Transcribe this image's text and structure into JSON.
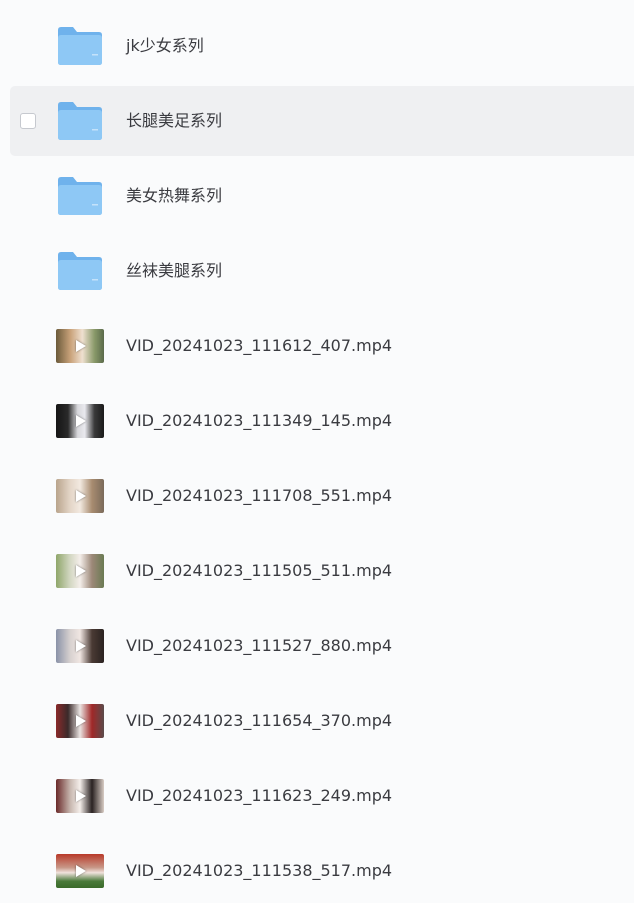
{
  "items": [
    {
      "type": "folder",
      "name": "jk少女系列",
      "selected": false
    },
    {
      "type": "folder",
      "name": "长腿美足系列",
      "selected": true
    },
    {
      "type": "folder",
      "name": "美女热舞系列",
      "selected": false
    },
    {
      "type": "folder",
      "name": "丝袜美腿系列",
      "selected": false
    },
    {
      "type": "video",
      "name": "VID_20241023_111612_407.mp4",
      "selected": false
    },
    {
      "type": "video",
      "name": "VID_20241023_111349_145.mp4",
      "selected": false
    },
    {
      "type": "video",
      "name": "VID_20241023_111708_551.mp4",
      "selected": false
    },
    {
      "type": "video",
      "name": "VID_20241023_111505_511.mp4",
      "selected": false
    },
    {
      "type": "video",
      "name": "VID_20241023_111527_880.mp4",
      "selected": false
    },
    {
      "type": "video",
      "name": "VID_20241023_111654_370.mp4",
      "selected": false
    },
    {
      "type": "video",
      "name": "VID_20241023_111623_249.mp4",
      "selected": false
    },
    {
      "type": "video",
      "name": "VID_20241023_111538_517.mp4",
      "selected": false
    }
  ],
  "icons": {
    "folder": "folder-icon",
    "video": "video-thumbnail",
    "play": "play-icon",
    "checkbox": "checkbox"
  },
  "colors": {
    "folder_body": "#8ec8f5",
    "folder_back": "#6fb2ec",
    "selected_row": "#eff0f2",
    "text": "#3a3b40"
  }
}
